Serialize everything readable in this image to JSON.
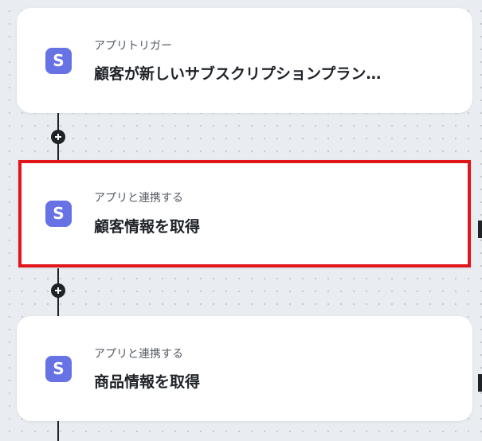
{
  "workflow": {
    "nodes": [
      {
        "icon": "stripe-s-icon",
        "icon_letter": "S",
        "subtitle": "アプリトリガー",
        "title": "顧客が新しいサブスクリプションプラン…",
        "selected": false
      },
      {
        "icon": "stripe-s-icon",
        "icon_letter": "S",
        "subtitle": "アプリと連携する",
        "title": "顧客情報を取得",
        "selected": true
      },
      {
        "icon": "stripe-s-icon",
        "icon_letter": "S",
        "subtitle": "アプリと連携する",
        "title": "商品情報を取得",
        "selected": false
      }
    ],
    "add_step_icon": "plus-icon"
  },
  "colors": {
    "canvas_bg": "#e9ecf0",
    "card_bg": "#ffffff",
    "icon_bg": "#6772e5",
    "selected_border": "#e0161c",
    "connector": "#1f2328"
  }
}
